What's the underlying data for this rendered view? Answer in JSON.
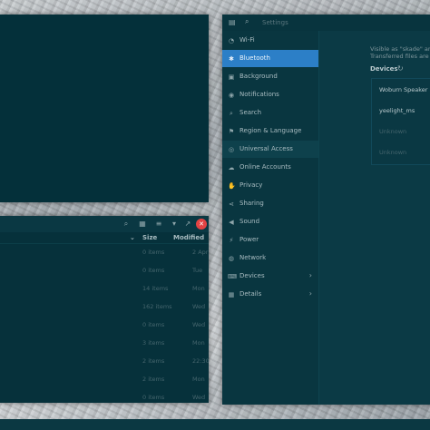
{
  "settings": {
    "title": "Settings",
    "sidebar": [
      {
        "label": "Wi-Fi",
        "icon": "wifi-icon",
        "glyph": "◔"
      },
      {
        "label": "Bluetooth",
        "icon": "bluetooth-icon",
        "glyph": "✱"
      },
      {
        "label": "Background",
        "icon": "background-icon",
        "glyph": "▣"
      },
      {
        "label": "Notifications",
        "icon": "notifications-icon",
        "glyph": "◉"
      },
      {
        "label": "Search",
        "icon": "search-icon",
        "glyph": "⌕"
      },
      {
        "label": "Region & Language",
        "icon": "flag-icon",
        "glyph": "⚑"
      },
      {
        "label": "Universal Access",
        "icon": "accessibility-icon",
        "glyph": "◎"
      },
      {
        "label": "Online Accounts",
        "icon": "cloud-icon",
        "glyph": "☁"
      },
      {
        "label": "Privacy",
        "icon": "hand-icon",
        "glyph": "✋"
      },
      {
        "label": "Sharing",
        "icon": "share-icon",
        "glyph": "⋖"
      },
      {
        "label": "Sound",
        "icon": "sound-icon",
        "glyph": "◀"
      },
      {
        "label": "Power",
        "icon": "power-icon",
        "glyph": "⚡"
      },
      {
        "label": "Network",
        "icon": "network-icon",
        "glyph": "◍"
      },
      {
        "label": "Devices",
        "icon": "devices-icon",
        "glyph": "⌨",
        "arrow": "›"
      },
      {
        "label": "Details",
        "icon": "details-icon",
        "glyph": "▦",
        "arrow": "›"
      }
    ],
    "panel": {
      "visible_text": "Visible as \"skade\" and",
      "transferred_text": "Transferred files are p",
      "devices_label": "Devices",
      "spinner": "↻",
      "devices": [
        {
          "name": "Woburn Speaker"
        },
        {
          "name": "yeelight_ms"
        },
        {
          "name": "Unknown"
        },
        {
          "name": "Unknown"
        }
      ]
    }
  },
  "files": {
    "columns": {
      "size": "Size",
      "modified": "Modified"
    },
    "rows": [
      {
        "size": "0 items",
        "modified": "2 Apr"
      },
      {
        "size": "0 items",
        "modified": "Tue"
      },
      {
        "size": "14 items",
        "modified": "Mon"
      },
      {
        "size": "162 items",
        "modified": "Wed"
      },
      {
        "size": "0 items",
        "modified": "Wed"
      },
      {
        "size": "3 items",
        "modified": "Mon"
      },
      {
        "size": "2 items",
        "modified": "22:30"
      },
      {
        "size": "2 items",
        "modified": "Mon"
      },
      {
        "size": "0 items",
        "modified": "Wed"
      }
    ]
  },
  "colors": {
    "accent": "#2c7fc7",
    "close": "#e34343"
  }
}
